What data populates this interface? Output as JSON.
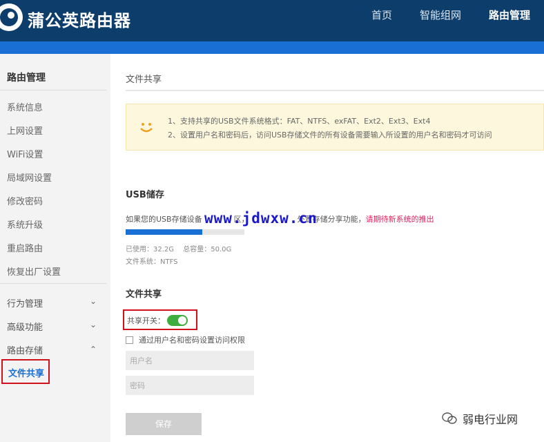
{
  "header": {
    "brand": "蒲公英路由器",
    "nav": [
      "首页",
      "智能组网",
      "路由管理"
    ],
    "active_nav": "路由管理"
  },
  "sidebar": {
    "title": "路由管理",
    "items": [
      "系统信息",
      "上网设置",
      "WiFi设置",
      "局域网设置",
      "修改密码",
      "系统升级",
      "重启路由",
      "恢复出厂设置"
    ],
    "groups": [
      {
        "label": "行为管理",
        "expanded": false
      },
      {
        "label": "高级功能",
        "expanded": false
      },
      {
        "label": "路由存储",
        "expanded": true
      }
    ],
    "active_sub": "文件共享"
  },
  "main": {
    "page_title": "文件共享",
    "notice": [
      "1、支持共享的USB文件系统格式：FAT、NTFS、exFAT、Ext2、Ext3、Ext4",
      "2、设置用户名和密码后，访问USB存储文件的所有设备需要输入所设置的用户名和密码才可访问"
    ],
    "usb": {
      "title": "USB储存",
      "desc_prefix": "如果您的USB存储设备",
      "desc_middle": "区，",
      "desc_after": "外置存储",
      "desc_end": "分享功能，",
      "desc_warn": "请期待新系统的推出",
      "used_label": "已使用：",
      "used": "32.2G",
      "total_label": "总容量：",
      "total": "50.0G",
      "fs_label": "文件系统：",
      "fs": "NTFS",
      "used_fraction": 0.644
    },
    "share": {
      "title": "文件共享",
      "toggle_label": "共享开关：",
      "toggle_on": true,
      "checkbox_label": "通过用户名和密码设置访问权限",
      "username_placeholder": "用户名",
      "password_placeholder": "密码",
      "save_label": "保存"
    }
  },
  "watermark": {
    "url": "www.jdwxw.cn",
    "brand": "弱电行业网"
  },
  "colors": {
    "header": "#0d3d6b",
    "accent": "#1a6fd4",
    "toggle": "#3fae3f",
    "warn": "#e0245e",
    "highlight_border": "#d0101a"
  }
}
